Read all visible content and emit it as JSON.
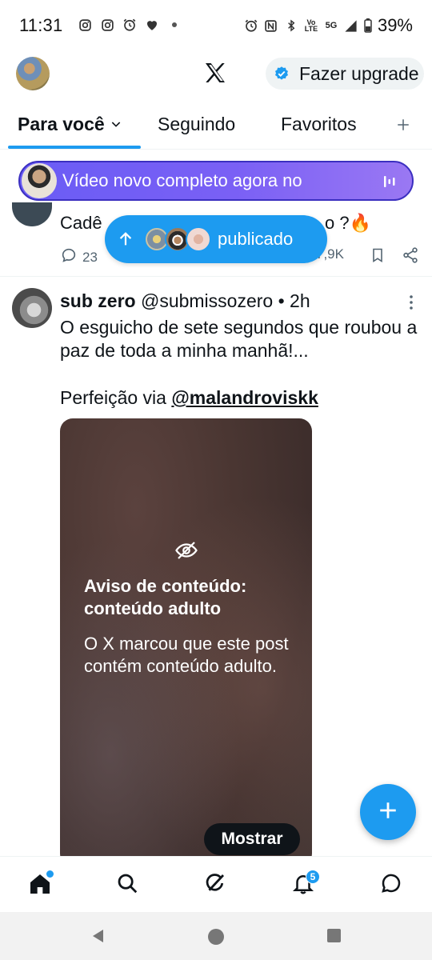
{
  "status_bar": {
    "time": "11:31",
    "battery": "39%",
    "network_label": "5G",
    "volte_label_top": "Vo",
    "volte_label_bottom": "LTE"
  },
  "header": {
    "logo": "X",
    "upgrade_label": "Fazer upgrade"
  },
  "tabs": [
    {
      "label": "Para você",
      "active": true
    },
    {
      "label": "Seguindo",
      "active": false
    },
    {
      "label": "Favoritos",
      "active": false
    }
  ],
  "spaces_banner": {
    "text": "Vídeo novo completo agora no"
  },
  "prev_tweet": {
    "text_start": "Cadê",
    "text_end": "o ?🔥",
    "reply_count": "23",
    "view_count": "7,9K"
  },
  "new_posts_pill": {
    "label": "publicado"
  },
  "tweet": {
    "name": "sub zero",
    "handle": "@submissozero",
    "separator": "•",
    "time": "2h",
    "body": "O esguicho de sete segundos que roubou a paz de toda a minha manhã!...",
    "line2_prefix": "Perfeição via",
    "mention": "@malandroviskk"
  },
  "content_warning": {
    "title": "Aviso de conteúdo: conteúdo adulto",
    "description": "O X marcou que este post contém conteúdo adulto.",
    "show_label": "Mostrar"
  },
  "bottom_nav": {
    "notifications_badge": "5"
  },
  "colors": {
    "accent": "#1d9bf0",
    "banner": "#7a60f5",
    "text": "#0f1419",
    "secondary": "#536471"
  }
}
